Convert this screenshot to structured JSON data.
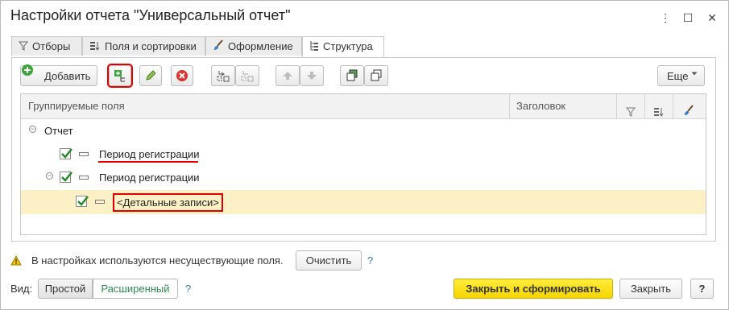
{
  "window": {
    "title": "Настройки отчета \"Универсальный отчет\"",
    "menu_icon": "more-vertical-icon",
    "maximize_icon": "maximize-icon",
    "close_icon": "close-icon"
  },
  "tabs": [
    {
      "label": "Отборы",
      "icon": "filter-icon"
    },
    {
      "label": "Поля и сортировки",
      "icon": "fields-sort-icon"
    },
    {
      "label": "Оформление",
      "icon": "brush-icon"
    },
    {
      "label": "Структура",
      "icon": "structure-icon",
      "active": true
    }
  ],
  "toolbar": {
    "add_label": "Добавить",
    "more_label": "Еще"
  },
  "grid": {
    "columns": [
      "Группируемые поля",
      "Заголовок"
    ],
    "rows": [
      {
        "label": "Отчет",
        "level": 0,
        "checkbox": false
      },
      {
        "label": "Период регистрации",
        "level": 1,
        "checkbox": true,
        "checked": true
      },
      {
        "label": "Период регистрации",
        "level": 1,
        "checkbox": true,
        "checked": true,
        "expandable": true
      },
      {
        "label": "<Детальные записи>",
        "level": 2,
        "checkbox": true,
        "checked": true,
        "selected": true
      }
    ]
  },
  "warning": {
    "text": "В настройках используются несуществующие поля.",
    "clear_label": "Очистить",
    "help": "?"
  },
  "view": {
    "label": "Вид:",
    "simple_label": "Простой",
    "extended_label": "Расширенный",
    "help": "?"
  },
  "footer": {
    "close_generate_label": "Закрыть и сформировать",
    "close_label": "Закрыть",
    "help_label": "?"
  },
  "colors": {
    "accent_yellow": "#f5d400",
    "selected_row": "#fbf0c6",
    "highlight_red": "#e00000",
    "checkmark_green": "#2a8a2a"
  }
}
